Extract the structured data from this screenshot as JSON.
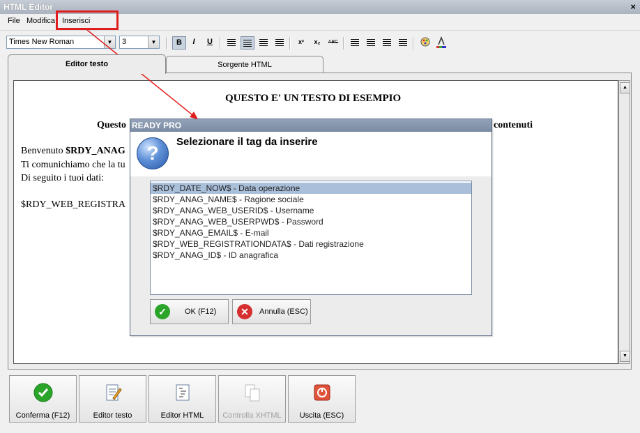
{
  "window": {
    "title": "HTML Editor",
    "close": "×"
  },
  "menu": {
    "items": [
      "File",
      "Modifica",
      "Inserisci"
    ]
  },
  "toolbar": {
    "font_family": "Times New Roman",
    "font_size": "3",
    "bold": "B",
    "italic": "I",
    "underline": "U",
    "sup": "x²",
    "sub": "x₂",
    "strike": "ABC"
  },
  "tabs": [
    {
      "label": "Editor testo",
      "active": true
    },
    {
      "label": "Sorgente HTML",
      "active": false
    }
  ],
  "editor": {
    "heading": "QUESTO E' UN TESTO DI ESEMPIO",
    "line2_start": "Questo",
    "line2_end": "contenuti",
    "welcome": "Benvenuto",
    "welcome_tag": "$RDY_ANAG",
    "line_comm": "Ti comunichiamo che la tu",
    "line_data": "Di seguito i tuoi dati:",
    "line_reg": "$RDY_WEB_REGISTRA"
  },
  "dialog": {
    "title": "READY PRO",
    "icon": "?",
    "message": "Selezionare il tag da inserire",
    "items": [
      "$RDY_DATE_NOW$ - Data operazione",
      "$RDY_ANAG_NAME$ - Ragione sociale",
      "$RDY_ANAG_WEB_USERID$ - Username",
      "$RDY_ANAG_WEB_USERPWD$ - Password",
      "$RDY_ANAG_EMAIL$ - E-mail",
      "$RDY_WEB_REGISTRATIONDATA$ - Dati registrazione",
      "$RDY_ANAG_ID$ - ID anagrafica"
    ],
    "selected_index": 0,
    "ok_label": "OK (F12)",
    "cancel_label": "Annulla (ESC)"
  },
  "bottom_buttons": [
    {
      "label": "Conferma (F12)",
      "icon": "check-circle-icon",
      "enabled": true
    },
    {
      "label": "Editor testo",
      "icon": "edit-document-icon",
      "enabled": true
    },
    {
      "label": "Editor HTML",
      "icon": "html-document-icon",
      "enabled": true
    },
    {
      "label": "Controlla XHTML",
      "icon": "validate-icon",
      "enabled": false
    },
    {
      "label": "Uscita (ESC)",
      "icon": "exit-icon",
      "enabled": true
    }
  ],
  "colors": {
    "annotation_red": "#e01e1e",
    "dialog_title_bg": "#7a8ba4",
    "selection_bg": "#a9bfda",
    "ok_green": "#2aa52a",
    "cancel_red": "#d62f2f"
  }
}
